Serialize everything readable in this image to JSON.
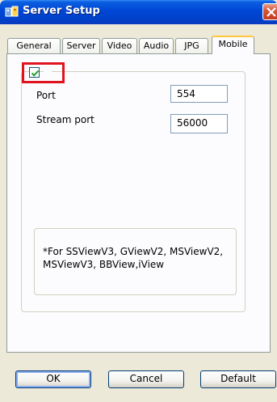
{
  "window": {
    "title": "Server Setup"
  },
  "tabs": [
    {
      "label": "General"
    },
    {
      "label": "Server"
    },
    {
      "label": "Video"
    },
    {
      "label": "Audio"
    },
    {
      "label": "JPG"
    },
    {
      "label": "Mobile",
      "active": true
    }
  ],
  "mobile": {
    "enabled": true,
    "port_label": "Port",
    "port_value": "554",
    "stream_port_label": "Stream port",
    "stream_port_value": "56000",
    "note": "*For SSViewV3, GViewV2, MSViewV2, MSViewV3, BBView,iView"
  },
  "buttons": {
    "ok": "OK",
    "cancel": "Cancel",
    "default": "Default"
  },
  "colors": {
    "titlebar": "#0046d5",
    "highlight": "#e0141e",
    "tab_active_top": "#ffc83c"
  }
}
